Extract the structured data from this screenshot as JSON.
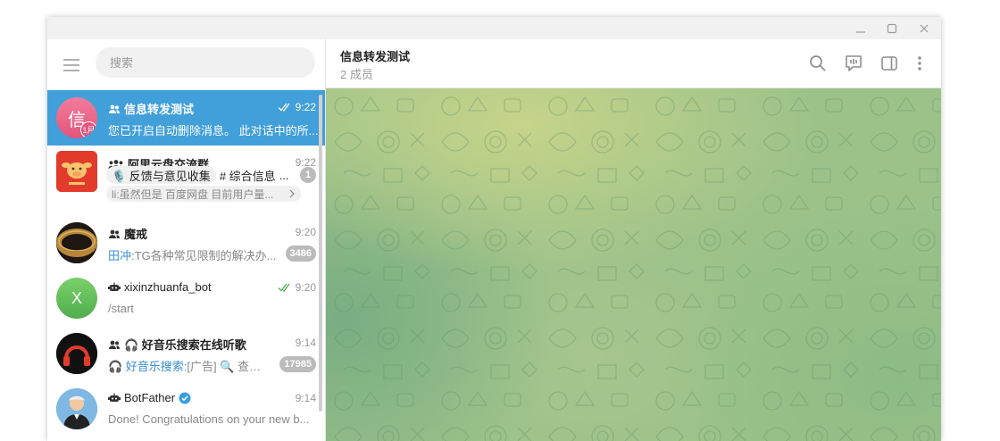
{
  "window": {
    "controls": [
      "minimize-icon",
      "maximize-icon",
      "close-icon"
    ]
  },
  "sidebar": {
    "search_placeholder": "搜索",
    "chats": [
      {
        "title": "信息转发测试",
        "time": "9:22",
        "preview": "您已开启自动删除消息。 此对话中的所...",
        "avatar_text": "信",
        "avatar_badge": "1月",
        "type": "group",
        "read": true,
        "active": true
      },
      {
        "title": "阿里云盘交流群",
        "time": "9:22",
        "type": "supergroup",
        "topic1": "🎙️ 反馈与意见收集",
        "topic2": "# 综合信息",
        "topic2_suffix": "...",
        "reply": "li:虽然但是 百度网盘 目前用户量...",
        "badge": "1"
      },
      {
        "title": "魔戒",
        "time": "9:20",
        "type": "group",
        "preview_sender": "田冲:",
        "preview": "TG各种常见限制的解决办...",
        "badge": "3486"
      },
      {
        "title": "xixinzhuanfa_bot",
        "time": "9:20",
        "type": "bot",
        "preview": "/start",
        "avatar_text": "X",
        "read": true
      },
      {
        "title": "🎧 好音乐搜索在线听歌",
        "time": "9:14",
        "type": "group",
        "preview_sender": "🎧 好音乐搜索:",
        "preview": "[广告] 🔍 查司...",
        "badge": "17985"
      },
      {
        "title": "BotFather",
        "time": "9:14",
        "type": "bot",
        "verified": true,
        "preview": "Done! Congratulations on your new b..."
      }
    ]
  },
  "main": {
    "title": "信息转发测试",
    "subtitle": "2 成员",
    "header_icons": [
      "search-icon",
      "group-call-icon",
      "sidebar-toggle-icon",
      "more-icon"
    ]
  },
  "colors": {
    "accent": "#419fd9",
    "badge": "#bbbbbb",
    "online_green": "#4fae4e"
  }
}
